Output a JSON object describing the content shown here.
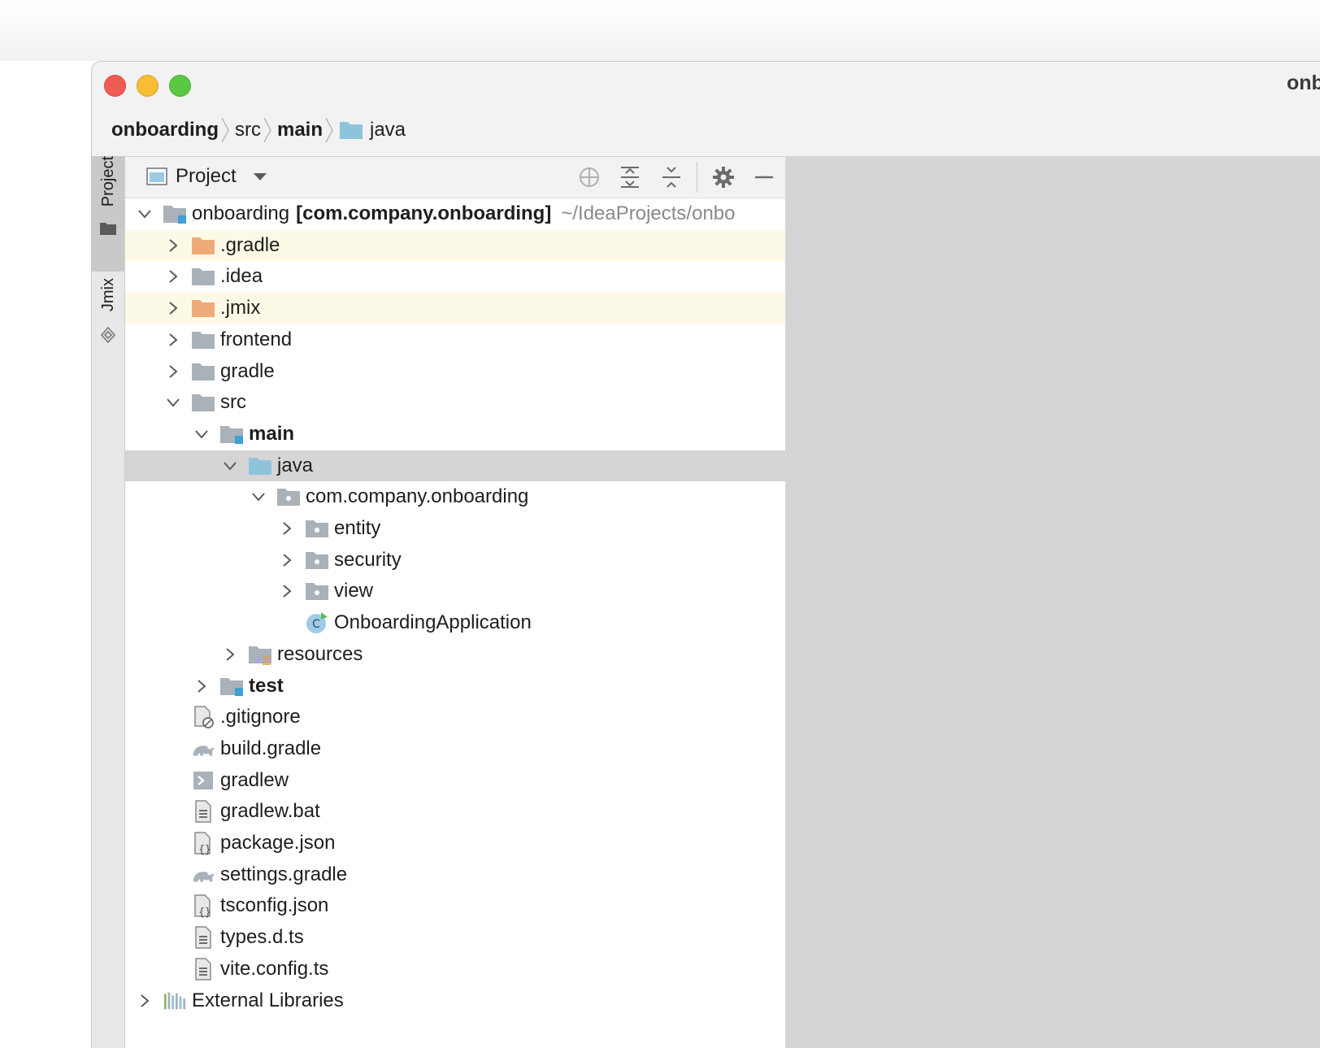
{
  "window": {
    "title": "onb"
  },
  "breadcrumb": [
    {
      "label": "onboarding",
      "bold": true,
      "icon": ""
    },
    {
      "label": "src",
      "bold": false,
      "icon": ""
    },
    {
      "label": "main",
      "bold": true,
      "icon": ""
    },
    {
      "label": "java",
      "bold": false,
      "icon": "folder-blue-icon"
    }
  ],
  "side_tabs": {
    "project": "Project",
    "jmix": "Jmix"
  },
  "panel": {
    "title": "Project",
    "tools": [
      "locate-icon",
      "expand-all-icon",
      "collapse-all-icon",
      "gear-icon",
      "hide-icon"
    ]
  },
  "tree": {
    "root": {
      "label": "onboarding",
      "module": "[com.company.onboarding]",
      "path": "~/IdeaProjects/onbo"
    },
    "items": [
      {
        "label": ".gradle",
        "depth": 1,
        "state": "collapsed",
        "icon": "folder-orange-icon",
        "style": "excluded"
      },
      {
        "label": ".idea",
        "depth": 1,
        "state": "collapsed",
        "icon": "folder-gray-icon",
        "style": ""
      },
      {
        "label": ".jmix",
        "depth": 1,
        "state": "collapsed",
        "icon": "folder-orange-icon",
        "style": "excluded"
      },
      {
        "label": "frontend",
        "depth": 1,
        "state": "collapsed",
        "icon": "folder-gray-icon",
        "style": ""
      },
      {
        "label": "gradle",
        "depth": 1,
        "state": "collapsed",
        "icon": "folder-gray-icon",
        "style": ""
      },
      {
        "label": "src",
        "depth": 1,
        "state": "expanded",
        "icon": "folder-gray-icon",
        "style": ""
      },
      {
        "label": "main",
        "depth": 2,
        "state": "expanded",
        "icon": "folder-module-icon",
        "style": "bold"
      },
      {
        "label": "java",
        "depth": 3,
        "state": "expanded",
        "icon": "folder-blue-icon",
        "style": "selected"
      },
      {
        "label": "com.company.onboarding",
        "depth": 4,
        "state": "expanded",
        "icon": "package-icon",
        "style": ""
      },
      {
        "label": "entity",
        "depth": 5,
        "state": "collapsed",
        "icon": "package-icon",
        "style": ""
      },
      {
        "label": "security",
        "depth": 5,
        "state": "collapsed",
        "icon": "package-icon",
        "style": ""
      },
      {
        "label": "view",
        "depth": 5,
        "state": "collapsed",
        "icon": "package-icon",
        "style": ""
      },
      {
        "label": "OnboardingApplication",
        "depth": 5,
        "state": "leaf",
        "icon": "spring-class-icon",
        "style": ""
      },
      {
        "label": "resources",
        "depth": 3,
        "state": "collapsed",
        "icon": "folder-resources-icon",
        "style": ""
      },
      {
        "label": "test",
        "depth": 2,
        "state": "collapsed",
        "icon": "folder-module-icon",
        "style": "bold"
      },
      {
        "label": ".gitignore",
        "depth": 1,
        "state": "leaf",
        "icon": "gitignore-icon",
        "style": ""
      },
      {
        "label": "build.gradle",
        "depth": 1,
        "state": "leaf",
        "icon": "gradle-elephant-icon",
        "style": ""
      },
      {
        "label": "gradlew",
        "depth": 1,
        "state": "leaf",
        "icon": "shell-script-icon",
        "style": ""
      },
      {
        "label": "gradlew.bat",
        "depth": 1,
        "state": "leaf",
        "icon": "text-file-icon",
        "style": ""
      },
      {
        "label": "package.json",
        "depth": 1,
        "state": "leaf",
        "icon": "json-file-icon",
        "style": ""
      },
      {
        "label": "settings.gradle",
        "depth": 1,
        "state": "leaf",
        "icon": "gradle-elephant-icon",
        "style": ""
      },
      {
        "label": "tsconfig.json",
        "depth": 1,
        "state": "leaf",
        "icon": "json-file-icon",
        "style": ""
      },
      {
        "label": "types.d.ts",
        "depth": 1,
        "state": "leaf",
        "icon": "text-file-icon",
        "style": ""
      },
      {
        "label": "vite.config.ts",
        "depth": 1,
        "state": "leaf",
        "icon": "text-file-icon",
        "style": ""
      },
      {
        "label": "External Libraries",
        "depth": 0,
        "state": "collapsed",
        "icon": "libraries-icon",
        "style": ""
      }
    ]
  },
  "colors": {
    "selected_row": "#d5d5d5",
    "excluded_row": "#fcfae6",
    "folder_gray": "#a9b1b9",
    "folder_orange": "#eeaa78",
    "folder_blue": "#8fc3dc",
    "module_marker": "#3f9fd6"
  }
}
